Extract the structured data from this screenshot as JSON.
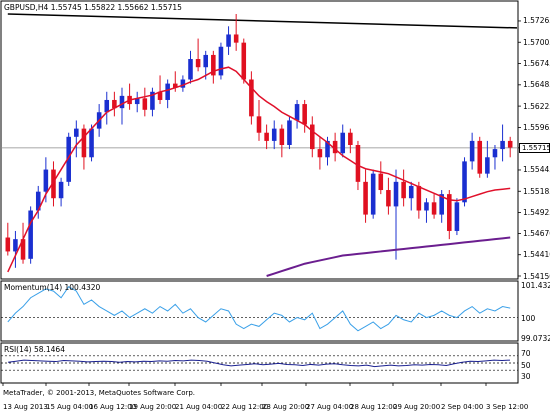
{
  "header": {
    "symbol_tf": "GBPUSD,H4",
    "ohlc": "1.55745 1.55822 1.55662 1.55715"
  },
  "momentum": {
    "label": "Momentum(14) 100.4320"
  },
  "rsi": {
    "label": "RSI(14) 58.1464"
  },
  "footer": {
    "copyright": "MetaTrader, © 2001-2013, MetaQuotes Software Corp."
  },
  "price_axis": [
    "1.57265",
    "1.57005",
    "1.56745",
    "1.56485",
    "1.56225",
    "1.55965",
    "1.55715",
    "1.55445",
    "1.55185",
    "1.54925",
    "1.54670",
    "1.54410",
    "1.54150"
  ],
  "current_price": "1.55715",
  "momentum_axis": [
    "101.4326",
    "100",
    "99.0732"
  ],
  "rsi_axis": [
    "70",
    "50",
    "30"
  ],
  "time_axis": [
    "13 Aug 2013",
    "15 Aug 04:00",
    "16 Aug 12:00",
    "19 Aug 20:00",
    "21 Aug 04:00",
    "22 Aug 12:00",
    "23 Aug 20:00",
    "27 Aug 04:00",
    "28 Aug 12:00",
    "29 Aug 20:00",
    "2 Sep 04:00",
    "3 Sep 12:00"
  ],
  "colors": {
    "bull": "#1a2fd0",
    "bear": "#e01020",
    "ma_fast": "#e0102a",
    "ma_slow": "#6b1e8f",
    "trendline": "#000000",
    "momentum_line": "#3aa0e8",
    "rsi_line": "#1a2090",
    "grid": "#000000"
  },
  "chart_data": {
    "type": "candlestick",
    "symbol": "GBPUSD",
    "timeframe": "H4",
    "ylim": [
      1.5415,
      1.5735
    ],
    "candles": [
      [
        1.5462,
        1.548,
        1.544,
        1.5445
      ],
      [
        1.5445,
        1.547,
        1.5425,
        1.546
      ],
      [
        1.546,
        1.548,
        1.543,
        1.5435
      ],
      [
        1.5436,
        1.55,
        1.543,
        1.5495
      ],
      [
        1.5495,
        1.5525,
        1.5485,
        1.5518
      ],
      [
        1.5518,
        1.556,
        1.5505,
        1.5545
      ],
      [
        1.5545,
        1.5555,
        1.55,
        1.551
      ],
      [
        1.551,
        1.5535,
        1.55,
        1.553
      ],
      [
        1.553,
        1.559,
        1.5525,
        1.5585
      ],
      [
        1.5585,
        1.5605,
        1.556,
        1.5595
      ],
      [
        1.5595,
        1.56,
        1.5545,
        1.556
      ],
      [
        1.556,
        1.56,
        1.5555,
        1.5595
      ],
      [
        1.5595,
        1.5625,
        1.5585,
        1.5615
      ],
      [
        1.5615,
        1.564,
        1.56,
        1.563
      ],
      [
        1.563,
        1.564,
        1.561,
        1.562
      ],
      [
        1.562,
        1.5645,
        1.56,
        1.5635
      ],
      [
        1.5635,
        1.565,
        1.5618,
        1.5625
      ],
      [
        1.5625,
        1.564,
        1.5615,
        1.5632
      ],
      [
        1.5632,
        1.5645,
        1.561,
        1.5618
      ],
      [
        1.5618,
        1.5645,
        1.561,
        1.564
      ],
      [
        1.564,
        1.566,
        1.5625,
        1.563
      ],
      [
        1.563,
        1.5655,
        1.562,
        1.565
      ],
      [
        1.565,
        1.5665,
        1.564,
        1.5645
      ],
      [
        1.5645,
        1.566,
        1.564,
        1.5655
      ],
      [
        1.5655,
        1.569,
        1.565,
        1.568
      ],
      [
        1.568,
        1.5705,
        1.5665,
        1.567
      ],
      [
        1.567,
        1.569,
        1.5655,
        1.5685
      ],
      [
        1.5685,
        1.569,
        1.565,
        1.566
      ],
      [
        1.566,
        1.57,
        1.5655,
        1.5695
      ],
      [
        1.5695,
        1.572,
        1.5685,
        1.571
      ],
      [
        1.571,
        1.5735,
        1.569,
        1.57
      ],
      [
        1.57,
        1.5705,
        1.565,
        1.5655
      ],
      [
        1.5655,
        1.5665,
        1.56,
        1.561
      ],
      [
        1.561,
        1.563,
        1.558,
        1.559
      ],
      [
        1.559,
        1.56,
        1.557,
        1.558
      ],
      [
        1.558,
        1.5605,
        1.557,
        1.5595
      ],
      [
        1.5595,
        1.56,
        1.556,
        1.5575
      ],
      [
        1.5575,
        1.561,
        1.557,
        1.5605
      ],
      [
        1.5605,
        1.563,
        1.5595,
        1.5625
      ],
      [
        1.5625,
        1.563,
        1.559,
        1.56
      ],
      [
        1.56,
        1.561,
        1.556,
        1.557
      ],
      [
        1.557,
        1.5585,
        1.5545,
        1.556
      ],
      [
        1.556,
        1.5585,
        1.555,
        1.558
      ],
      [
        1.558,
        1.559,
        1.5555,
        1.5565
      ],
      [
        1.5565,
        1.56,
        1.556,
        1.559
      ],
      [
        1.559,
        1.5595,
        1.5565,
        1.5575
      ],
      [
        1.5575,
        1.558,
        1.552,
        1.553
      ],
      [
        1.553,
        1.5545,
        1.548,
        1.549
      ],
      [
        1.549,
        1.5545,
        1.5485,
        1.554
      ],
      [
        1.554,
        1.5555,
        1.5515,
        1.552
      ],
      [
        1.552,
        1.5535,
        1.549,
        1.55
      ],
      [
        1.55,
        1.5545,
        1.5435,
        1.553
      ],
      [
        1.553,
        1.5545,
        1.55,
        1.551
      ],
      [
        1.551,
        1.553,
        1.5495,
        1.5525
      ],
      [
        1.5525,
        1.553,
        1.5485,
        1.5495
      ],
      [
        1.5495,
        1.551,
        1.548,
        1.5505
      ],
      [
        1.5505,
        1.5515,
        1.5485,
        1.549
      ],
      [
        1.549,
        1.552,
        1.548,
        1.5515
      ],
      [
        1.5515,
        1.552,
        1.546,
        1.547
      ],
      [
        1.547,
        1.551,
        1.5465,
        1.5505
      ],
      [
        1.5505,
        1.556,
        1.55,
        1.5555
      ],
      [
        1.5555,
        1.559,
        1.5545,
        1.558
      ],
      [
        1.558,
        1.5585,
        1.5535,
        1.554
      ],
      [
        1.554,
        1.558,
        1.5535,
        1.556
      ],
      [
        1.556,
        1.5575,
        1.5545,
        1.557
      ],
      [
        1.557,
        1.56,
        1.5555,
        1.558
      ],
      [
        1.558,
        1.5585,
        1.556,
        1.5572
      ]
    ],
    "ma_fast": [
      1.542,
      1.544,
      1.546,
      1.548,
      1.5495,
      1.5515,
      1.553,
      1.5545,
      1.556,
      1.5575,
      1.5585,
      1.5595,
      1.5605,
      1.5615,
      1.562,
      1.5625,
      1.563,
      1.5632,
      1.5634,
      1.5636,
      1.564,
      1.5642,
      1.5645,
      1.5648,
      1.5652,
      1.5655,
      1.566,
      1.5665,
      1.5668,
      1.567,
      1.5665,
      1.5655,
      1.5645,
      1.5635,
      1.5628,
      1.5622,
      1.5615,
      1.561,
      1.5605,
      1.56,
      1.5592,
      1.5585,
      1.5578,
      1.557,
      1.5562,
      1.5556,
      1.555,
      1.5546,
      1.5544,
      1.5542,
      1.554,
      1.5536,
      1.5532,
      1.5528,
      1.5524,
      1.552,
      1.5516,
      1.5512,
      1.5508,
      1.5507,
      1.5509,
      1.5512,
      1.5515,
      1.5518,
      1.552,
      1.5521,
      1.5522
    ],
    "ma_slow_start_index": 34,
    "ma_slow": [
      1.5415,
      1.5418,
      1.5421,
      1.5424,
      1.5427,
      1.543,
      1.5432,
      1.5434,
      1.5436,
      1.5438,
      1.544,
      1.5441,
      1.5442,
      1.5443,
      1.5444,
      1.5445,
      1.5446,
      1.5447,
      1.5448,
      1.5449,
      1.545,
      1.5451,
      1.5452,
      1.5453,
      1.5454,
      1.5455,
      1.5456,
      1.5457,
      1.5458,
      1.5459,
      1.546,
      1.5461,
      1.5462
    ],
    "trendline": {
      "from": [
        0,
        1.5735
      ],
      "to": [
        66,
        1.5718
      ]
    },
    "momentum": {
      "ylim": [
        99.0732,
        101.4326
      ],
      "values": [
        99.8,
        100.2,
        100.5,
        100.9,
        101.1,
        101.3,
        101.2,
        100.9,
        101.4,
        101.2,
        100.6,
        100.8,
        100.5,
        100.3,
        100.1,
        100.3,
        100.0,
        100.2,
        100.4,
        100.2,
        100.5,
        100.3,
        100.6,
        100.2,
        100.4,
        100.0,
        99.8,
        100.1,
        100.4,
        100.3,
        99.7,
        99.5,
        99.7,
        99.6,
        99.9,
        100.2,
        100.1,
        99.8,
        100.0,
        99.9,
        100.2,
        99.5,
        99.7,
        100.0,
        100.3,
        99.7,
        99.4,
        99.6,
        99.8,
        99.5,
        99.7,
        100.1,
        99.9,
        99.8,
        100.2,
        100.0,
        100.1,
        100.3,
        100.1,
        100.0,
        100.3,
        100.5,
        100.2,
        100.4,
        100.3,
        100.5,
        100.43
      ]
    },
    "rsi": {
      "ylim": [
        0,
        100
      ],
      "levels": [
        70,
        50,
        30
      ],
      "values": [
        52,
        55,
        58,
        57,
        56,
        55,
        54,
        57,
        56,
        55,
        53,
        54,
        55,
        54,
        52,
        54,
        53,
        55,
        54,
        56,
        55,
        57,
        56,
        58,
        57,
        55,
        50,
        45,
        42,
        44,
        46,
        48,
        45,
        47,
        49,
        46,
        45,
        43,
        46,
        44,
        47,
        48,
        45,
        43,
        42,
        44,
        40,
        42,
        44,
        42,
        43,
        45,
        44,
        46,
        45,
        43,
        48,
        52,
        55,
        54,
        56,
        58,
        57,
        58
      ]
    }
  }
}
